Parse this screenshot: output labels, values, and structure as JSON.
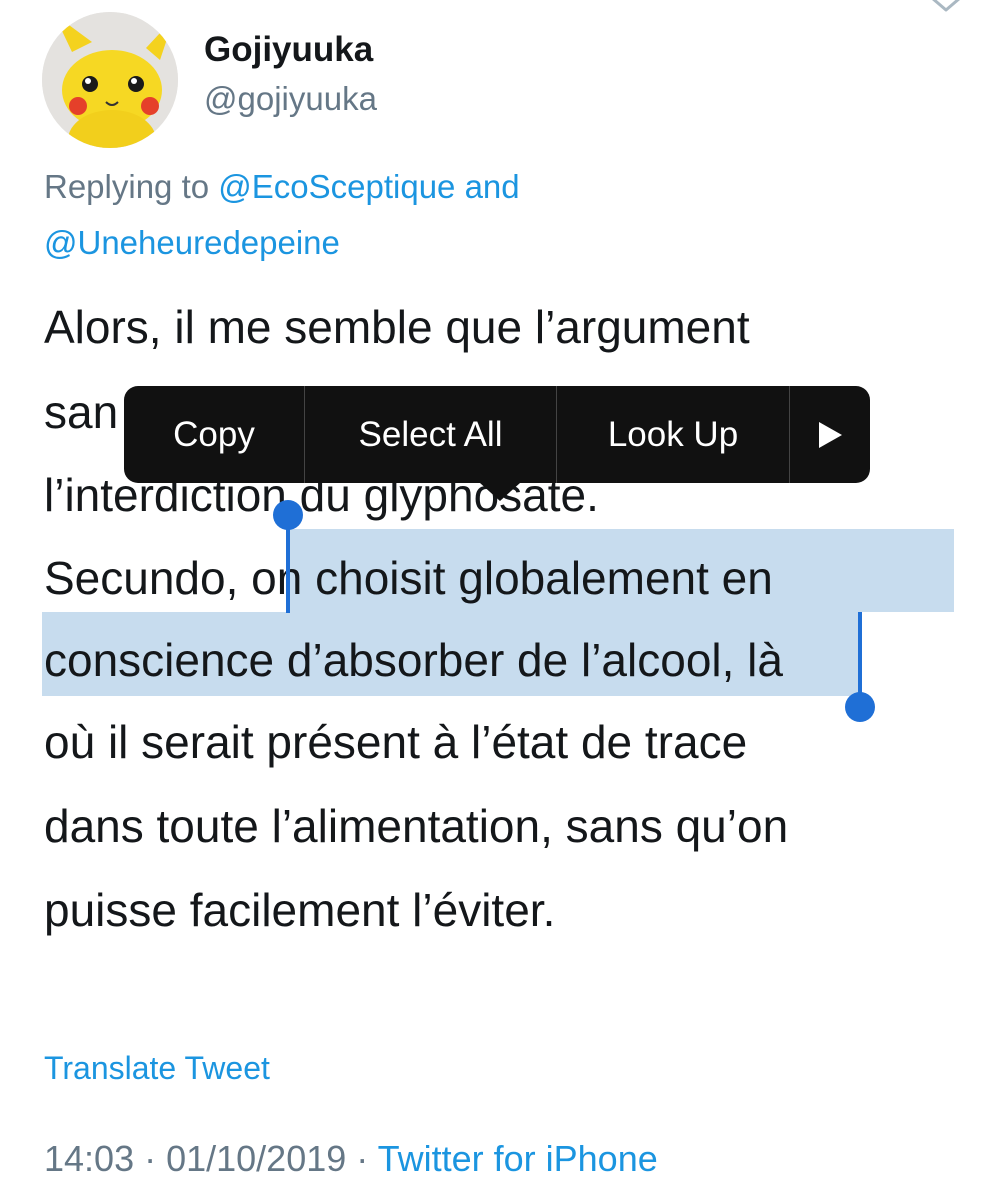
{
  "tweet": {
    "display_name": "Gojiyuuka",
    "handle": "@gojiyuuka",
    "avatar_icon": "pikachu-avatar",
    "reply": {
      "prefix": "Replying to ",
      "mention1": "@EcoSceptique",
      "conjunction": " and",
      "mention2": "@Uneheuredepeine"
    },
    "lines": {
      "l1": "Alors, il me semble que l’argument",
      "l2": "san",
      "l3": "l’interdiction du glyphosate.",
      "l4_before": "Secundo, ",
      "l4_selected": "on choisit globalement en",
      "l5_selected": "conscience d’absorber de l’alcool",
      "l5_after": ", là",
      "l6": "où il serait présent à l’état de trace",
      "l7": "dans toute l’alimentation, sans qu’on",
      "l8": "puisse facilement l’éviter."
    },
    "translate_label": "Translate Tweet",
    "meta": {
      "time": "14:03",
      "sep1": " · ",
      "date": "01/10/2019",
      "sep2": " · ",
      "source": "Twitter for iPhone"
    }
  },
  "context_menu": {
    "copy": "Copy",
    "select_all": "Select All",
    "look_up": "Look Up",
    "more_icon": "play-triangle-icon"
  },
  "colors": {
    "link": "#1b95e0",
    "secondary": "#657786",
    "selection": "#c7dcee",
    "handle": "#1f6fd6",
    "menu_bg": "#111111"
  }
}
